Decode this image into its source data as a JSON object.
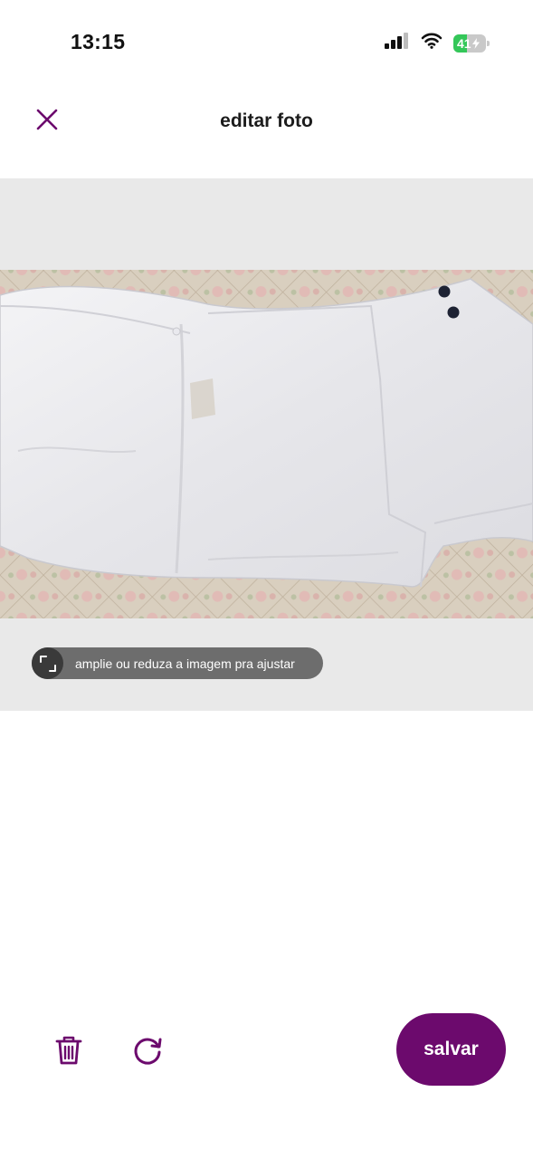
{
  "status_bar": {
    "time": "13:15",
    "battery_level": "41",
    "icons": [
      "cellular-signal-icon",
      "wifi-icon",
      "battery-charging-icon"
    ]
  },
  "header": {
    "title": "editar foto",
    "close_icon": "close-icon"
  },
  "editor": {
    "photo_description_icon": "product-photo",
    "hint_text": "amplie ou reduza a imagem pra ajustar",
    "hint_icon": "resize-icon"
  },
  "toolbar": {
    "delete_icon": "trash-icon",
    "rotate_icon": "rotate-icon",
    "save_label": "salvar"
  },
  "colors": {
    "accent": "#6c0a6d",
    "editor_background": "#e9e9e9",
    "hint_background": "#6d6d6d",
    "battery_green": "#34c759"
  }
}
